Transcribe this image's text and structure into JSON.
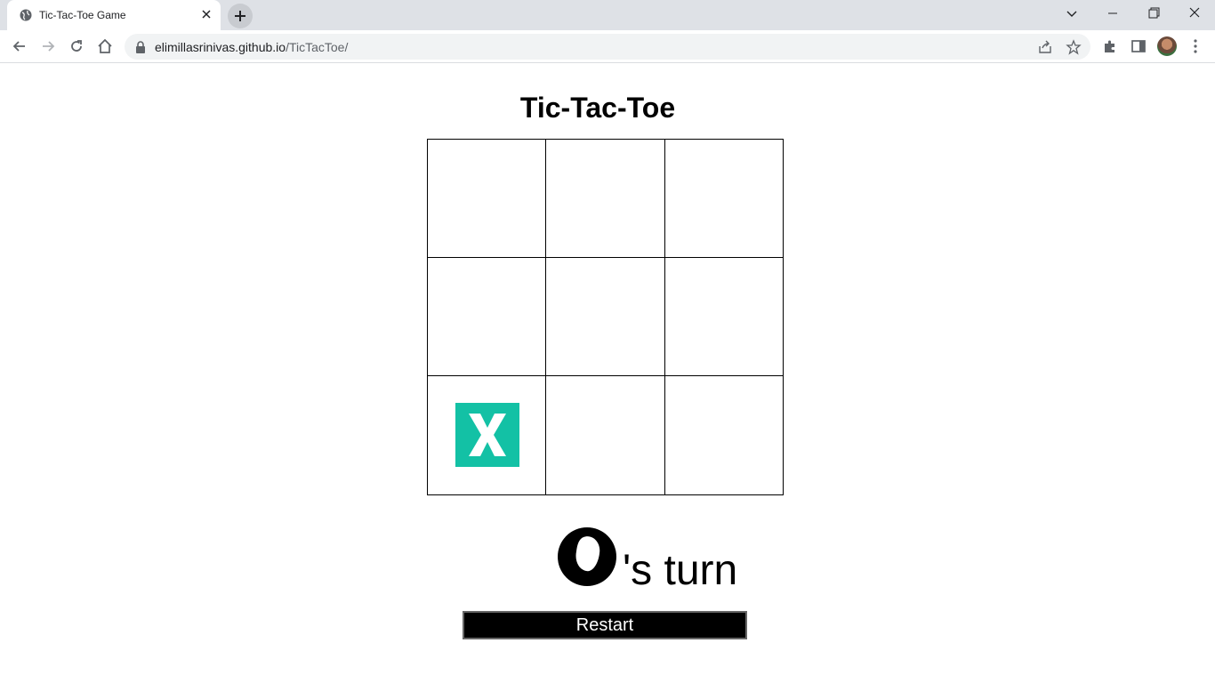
{
  "browser": {
    "tab_title": "Tic-Tac-Toe Game",
    "url_host": "elimillasrinivas.github.io",
    "url_path": "/TicTacToe/"
  },
  "game": {
    "title": "Tic-Tac-Toe",
    "board": [
      [
        "",
        "",
        ""
      ],
      [
        "",
        "",
        ""
      ],
      [
        "X",
        "",
        ""
      ]
    ],
    "x_color": "#13c1a5",
    "turn_player": "O",
    "turn_text": "'s turn",
    "restart_label": "Restart"
  }
}
